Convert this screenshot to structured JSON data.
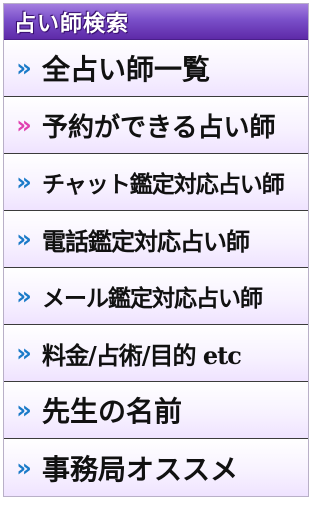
{
  "header": {
    "title": "占い師検索"
  },
  "menu": {
    "items": [
      {
        "label": "全占い師一覧",
        "chevron": "»",
        "chevron_color": "#1a7ac8"
      },
      {
        "label": "予約ができる占い師",
        "chevron": "»",
        "chevron_color": "#e040b0"
      },
      {
        "label": "チャット鑑定対応占い師",
        "chevron": "»",
        "chevron_color": "#1a7ac8"
      },
      {
        "label": "電話鑑定対応占い師",
        "chevron": "»",
        "chevron_color": "#1a7ac8"
      },
      {
        "label": "メール鑑定対応占い師",
        "chevron": "»",
        "chevron_color": "#1a7ac8"
      },
      {
        "label": "料金/占術/目的 etc",
        "chevron": "»",
        "chevron_color": "#1a7ac8"
      },
      {
        "label": "先生の名前",
        "chevron": "»",
        "chevron_color": "#1a7ac8"
      },
      {
        "label": "事務局オススメ",
        "chevron": "»",
        "chevron_color": "#1a7ac8"
      }
    ]
  },
  "colors": {
    "header_bg": "#7a4fc9",
    "item_bg": "#f7f1ff",
    "accent_blue": "#1a7ac8",
    "accent_pink": "#e040b0"
  }
}
